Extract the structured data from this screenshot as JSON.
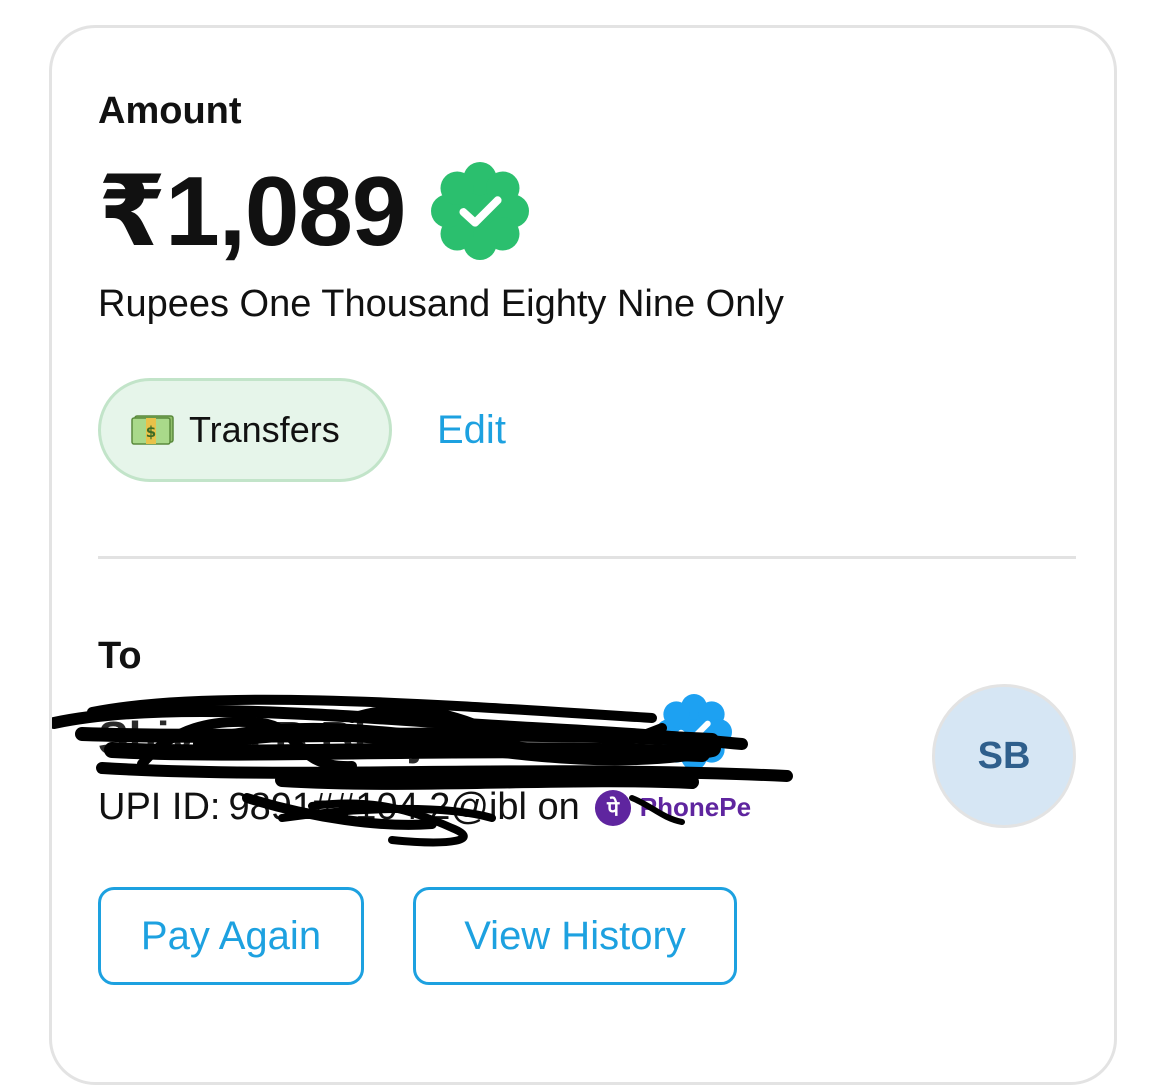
{
  "amount": {
    "label": "Amount",
    "value": "₹1,089",
    "words": "Rupees One Thousand Eighty Nine Only",
    "verified_icon": "verified-badge-icon",
    "verified_color": "#2bbf6e"
  },
  "category": {
    "icon": "money-icon",
    "label": "Transfers",
    "edit_label": "Edit"
  },
  "recipient": {
    "label": "To",
    "name": "Shivani B Bhujanti",
    "upi_label": "UPI ID:",
    "upi_value": "9891##104 2@ibl on",
    "provider": "PhonePe",
    "provider_color": "#5f259f",
    "avatar_initials": "SB",
    "verified_color": "#1da1f2"
  },
  "actions": {
    "pay_again": "Pay Again",
    "view_history": "View History"
  },
  "colors": {
    "accent": "#1da1e0",
    "chip_bg": "#e6f5ea",
    "chip_border": "#c2e4c9",
    "avatar_bg": "#d6e6f4"
  }
}
